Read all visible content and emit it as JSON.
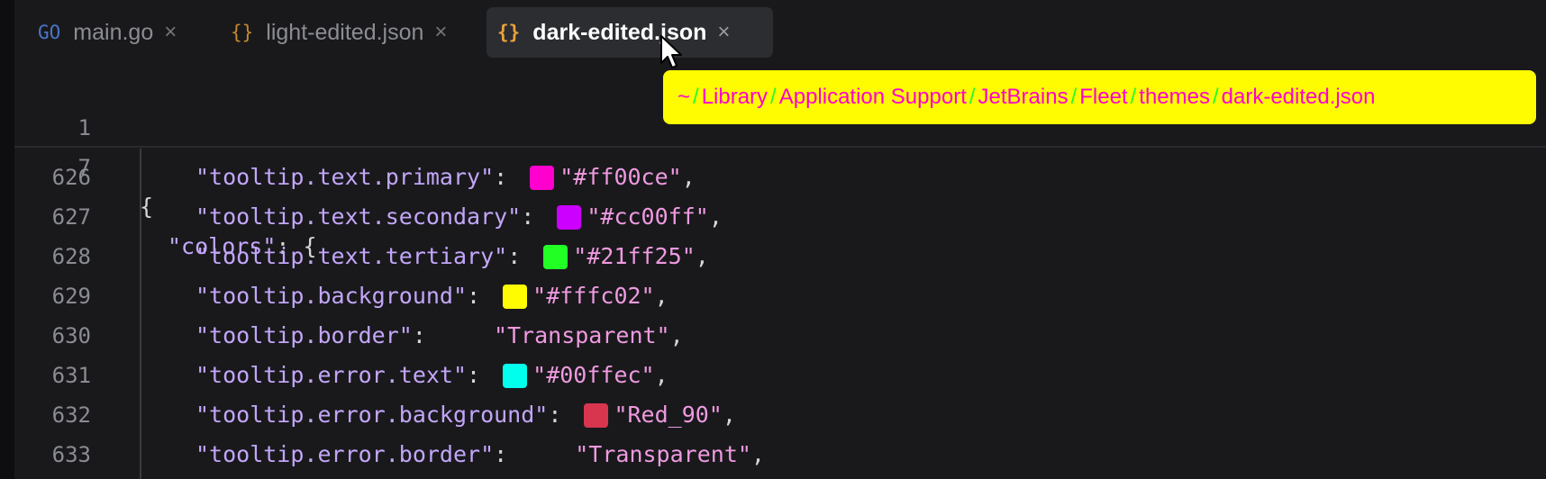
{
  "tabs": [
    {
      "icon": "GO",
      "label": "main.go",
      "close": "×",
      "active": false
    },
    {
      "icon": "{}",
      "label": "light-edited.json",
      "close": "×",
      "active": false
    },
    {
      "icon": "{}",
      "label": "dark-edited.json",
      "close": "×",
      "active": true
    }
  ],
  "tooltip": {
    "segments": [
      "~",
      "Library",
      "Application Support",
      "JetBrains",
      "Fleet",
      "themes",
      "dark-edited.json"
    ],
    "separator": "/",
    "colors": {
      "text": "#ff00ce",
      "separator": "#21ff25",
      "background": "#fffc02"
    }
  },
  "sticky_lines": [
    {
      "number": "1",
      "text": "{"
    },
    {
      "number": "7",
      "key": "\"colors\"",
      "rest": ": {"
    }
  ],
  "lines": [
    {
      "number": "626",
      "key": "\"tooltip.text.primary\"",
      "swatch": "#ff00ce",
      "value": "\"#ff00ce\""
    },
    {
      "number": "627",
      "key": "\"tooltip.text.secondary\"",
      "swatch": "#cc00ff",
      "value": "\"#cc00ff\""
    },
    {
      "number": "628",
      "key": "\"tooltip.text.tertiary\"",
      "swatch": "#21ff25",
      "value": "\"#21ff25\""
    },
    {
      "number": "629",
      "key": "\"tooltip.background\"",
      "swatch": "#fffc02",
      "value": "\"#fffc02\""
    },
    {
      "number": "630",
      "key": "\"tooltip.border\"",
      "swatch": "",
      "value": "\"Transparent\""
    },
    {
      "number": "631",
      "key": "\"tooltip.error.text\"",
      "swatch": "#00ffec",
      "value": "\"#00ffec\""
    },
    {
      "number": "632",
      "key": "\"tooltip.error.background\"",
      "swatch": "#d8354e",
      "value": "\"Red_90\""
    },
    {
      "number": "633",
      "key": "\"tooltip.error.border\"",
      "swatch": "",
      "value": "\"Transparent\""
    }
  ],
  "punctuation": {
    "colon": ": ",
    "comma": ","
  }
}
